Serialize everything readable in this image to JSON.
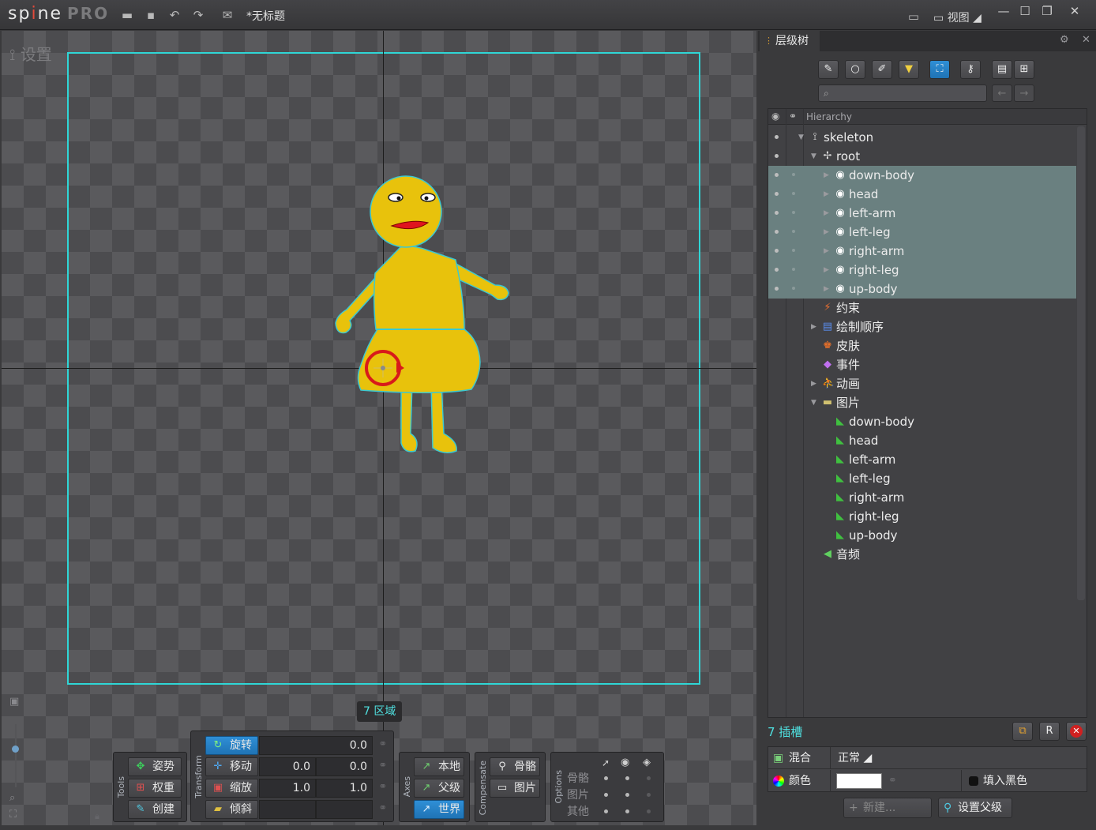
{
  "app": {
    "logo_main": "sp",
    "logo_dot": "i",
    "logo_rest": "ne",
    "logo_pro": "PRO",
    "doc_title": "*无标题",
    "view_label": "视图"
  },
  "viewport": {
    "mode_label": "设置",
    "region_badge": "7 区域"
  },
  "tools": {
    "label": "Tools",
    "items": [
      {
        "label": "姿势",
        "icon": "pose-icon"
      },
      {
        "label": "权重",
        "icon": "weights-icon"
      },
      {
        "label": "创建",
        "icon": "create-icon"
      }
    ]
  },
  "transform": {
    "label": "Transform",
    "rotate": {
      "label": "旋转",
      "value": "0.0"
    },
    "translate": {
      "label": "移动",
      "x": "0.0",
      "y": "0.0"
    },
    "scale": {
      "label": "缩放",
      "x": "1.0",
      "y": "1.0"
    },
    "shear": {
      "label": "倾斜",
      "x": "",
      "y": ""
    }
  },
  "axes": {
    "label": "Axes",
    "local": "本地",
    "parent": "父级",
    "world": "世界"
  },
  "compensate": {
    "label": "Compensate",
    "bones": "骨骼",
    "images": "图片"
  },
  "options": {
    "label": "Options",
    "rows": [
      "骨骼",
      "图片",
      "其他"
    ]
  },
  "panel": {
    "tab_label": "层级树",
    "search_placeholder": "",
    "tree_header": "Hierarchy",
    "tree": [
      {
        "label": "skeleton",
        "depth": 0,
        "expanded": true,
        "icon": "skeleton-icon",
        "selected": false
      },
      {
        "label": "root",
        "depth": 1,
        "expanded": true,
        "icon": "bone-icon",
        "selected": false
      },
      {
        "label": "down-body",
        "depth": 2,
        "expanded": false,
        "icon": "slot-icon",
        "selected": true
      },
      {
        "label": "head",
        "depth": 2,
        "expanded": false,
        "icon": "slot-icon",
        "selected": true
      },
      {
        "label": "left-arm",
        "depth": 2,
        "expanded": false,
        "icon": "slot-icon",
        "selected": true
      },
      {
        "label": "left-leg",
        "depth": 2,
        "expanded": false,
        "icon": "slot-icon",
        "selected": true
      },
      {
        "label": "right-arm",
        "depth": 2,
        "expanded": false,
        "icon": "slot-icon",
        "selected": true
      },
      {
        "label": "right-leg",
        "depth": 2,
        "expanded": false,
        "icon": "slot-icon",
        "selected": true
      },
      {
        "label": "up-body",
        "depth": 2,
        "expanded": false,
        "icon": "slot-icon",
        "selected": true
      },
      {
        "label": "约束",
        "depth": 1,
        "icon": "constraints-icon",
        "selected": false
      },
      {
        "label": "绘制顺序",
        "depth": 1,
        "expanded": false,
        "icon": "draw-order-icon",
        "selected": false
      },
      {
        "label": "皮肤",
        "depth": 1,
        "icon": "skins-icon",
        "selected": false
      },
      {
        "label": "事件",
        "depth": 1,
        "icon": "events-icon",
        "selected": false
      },
      {
        "label": "动画",
        "depth": 1,
        "expanded": false,
        "icon": "animations-icon",
        "selected": false
      },
      {
        "label": "图片",
        "depth": 1,
        "expanded": true,
        "icon": "images-folder-icon",
        "selected": false
      },
      {
        "label": "down-body",
        "depth": 2,
        "icon": "image-icon",
        "selected": false
      },
      {
        "label": "head",
        "depth": 2,
        "icon": "image-icon",
        "selected": false
      },
      {
        "label": "left-arm",
        "depth": 2,
        "icon": "image-icon",
        "selected": false
      },
      {
        "label": "left-leg",
        "depth": 2,
        "icon": "image-icon",
        "selected": false
      },
      {
        "label": "right-arm",
        "depth": 2,
        "icon": "image-icon",
        "selected": false
      },
      {
        "label": "right-leg",
        "depth": 2,
        "icon": "image-icon",
        "selected": false
      },
      {
        "label": "up-body",
        "depth": 2,
        "icon": "image-icon",
        "selected": false
      },
      {
        "label": "音频",
        "depth": 1,
        "icon": "audio-icon",
        "selected": false
      }
    ],
    "slots_count_label": "7 插槽",
    "blend_label": "混合",
    "blend_value": "正常",
    "color_label": "颜色",
    "tint_black_label": "填入黑色",
    "new_button": "新建...",
    "set_parent_button": "设置父级"
  },
  "colors": {
    "accent": "#2fd6d6",
    "selection": "#6a8080",
    "active_button": "#2f8fd6",
    "character_fill": "#e8c20c"
  }
}
